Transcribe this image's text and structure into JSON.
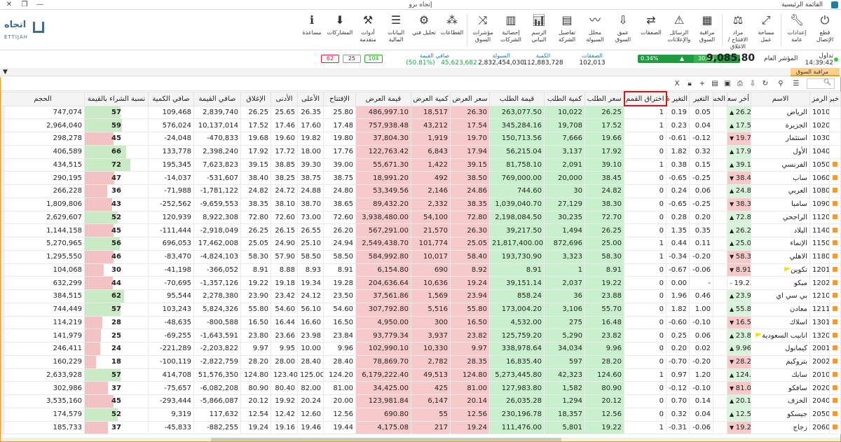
{
  "titlebar": {
    "title": "إتجاه برو",
    "menu": "القائمة الرئيسية"
  },
  "ribbon": [
    {
      "icon": "power-icon",
      "label": "قطع الإتصال"
    },
    {
      "icon": "wrench-icon",
      "label": "إعدادات عامة"
    },
    {
      "icon": "expand-icon",
      "label": "مساحة عمل"
    },
    {
      "icon": "auction-icon",
      "label": "مزاد الافتتاح / الاغلاق"
    },
    {
      "icon": "grid-icon",
      "label": "مراقبة السوق"
    },
    {
      "icon": "alert-icon",
      "label": "الرسائل والإعلانات"
    },
    {
      "icon": "deals-icon",
      "label": "الصفقات"
    },
    {
      "icon": "depth-icon",
      "label": "عمق السوق"
    },
    {
      "icon": "liquidity-icon",
      "label": "محلل السيولة"
    },
    {
      "icon": "company-icon",
      "label": "تفاصيل الشركة"
    },
    {
      "icon": "chart-icon",
      "label": "الرسم البياني"
    },
    {
      "icon": "stats-icon",
      "label": "إحصائية الشركات"
    },
    {
      "icon": "shuffle-icon",
      "label": "مؤشرات السوق"
    },
    {
      "icon": "sectors-icon",
      "label": "القطاعات"
    },
    {
      "icon": "analysis-icon",
      "label": "تحليل فني"
    },
    {
      "icon": "financial-icon",
      "label": "البيانات المالية"
    },
    {
      "icon": "tools-icon",
      "label": "أدوات متقدمة"
    },
    {
      "icon": "subscriptions-icon",
      "label": "المشاركات"
    },
    {
      "icon": "help-icon",
      "label": "مساعدة"
    }
  ],
  "logo": {
    "ar": "اتجاه",
    "en": "ETTIJAH"
  },
  "ticker": {
    "trade_label": "تداول",
    "time": "14:39:42",
    "index_label": "المؤشر العام",
    "index_value": "9,085.80",
    "index_change": "30.46",
    "index_pct": "0.34%",
    "deals_label": "الصفقات",
    "deals_value": "102,013",
    "qty_label": "الكمية",
    "qty_value": "112,883,728",
    "liquidity_label": "السيولة",
    "liquidity_value": "2,832,454,030",
    "netval_label": "صافي القيمة",
    "netval_value": "45,623,682",
    "netval_pct": "(50.81%)",
    "up_count": "104",
    "flat_count": "25",
    "down_count": "62"
  },
  "panel": {
    "title": "مراقبة السوق",
    "search_placeholder": ""
  },
  "columns": [
    "خبر",
    "الرمز",
    "الاسم",
    "أخر سعر",
    "الخسارة",
    "التغير",
    "التغير %",
    "اختراق القمم",
    "سعر الطلب",
    "كمية الطلب",
    "قيمة الطلب",
    "سعر العرض",
    "كمية العرض",
    "قيمة العرض",
    "الإفتتاح",
    "الأعلى",
    "الأدنى",
    "الإغلاق",
    "صافي القيمة",
    "صافي الكمية",
    "نسبة الشراء بالقيمة",
    "الحجم"
  ],
  "rows": [
    {
      "sym": "1010",
      "name": "الرياض",
      "last": "26.25",
      "dir": "up",
      "chg": "0.05",
      "pct": "0.19",
      "brk": "1",
      "bp": "26.25",
      "bq": "10,022",
      "bv": "263,077.50",
      "ap": "26.30",
      "aq": "18,517",
      "av": "486,997.10",
      "open": "25.80",
      "high": "26.35",
      "low": "25.65",
      "close": "26.25",
      "netv": "2,839,740",
      "netq": "109,468",
      "ratio": 57,
      "vol": "747,074",
      "flag": false,
      "rss": false
    },
    {
      "sym": "1020",
      "name": "الجزيرة",
      "last": "17.54",
      "dir": "up",
      "chg": "0.04",
      "pct": "0.23",
      "brk": "1",
      "bp": "17.52",
      "bq": "19,708",
      "bv": "345,284.16",
      "ap": "17.54",
      "aq": "43,212",
      "av": "757,938.48",
      "open": "17.48",
      "high": "17.60",
      "low": "17.46",
      "close": "17.52",
      "netv": "10,137,014",
      "netq": "576,024",
      "ratio": 59,
      "vol": "2,964,040",
      "flag": false,
      "rss": false
    },
    {
      "sym": "1030",
      "name": "استثمار",
      "last": "19.70",
      "dir": "down",
      "chg": "-0.12",
      "pct": "-0.61",
      "brk": "0",
      "bp": "19.66",
      "bq": "7,666",
      "bv": "150,713.56",
      "ap": "19.70",
      "aq": "1,919",
      "av": "37,804.30",
      "open": "19.80",
      "high": "19.82",
      "low": "19.60",
      "close": "19.68",
      "netv": "-470,833",
      "netq": "-24,048",
      "ratio": 45,
      "vol": "298,278",
      "flag": false,
      "rss": false
    },
    {
      "sym": "1040",
      "name": "الأول",
      "last": "17.92",
      "dir": "up",
      "chg": "0.32",
      "pct": "1.82",
      "brk": "0",
      "bp": "17.92",
      "bq": "3,137",
      "bv": "56,215.04",
      "ap": "17.94",
      "aq": "6,843",
      "av": "122,763.42",
      "open": "17.76",
      "high": "18.00",
      "low": "17.72",
      "close": "17.92",
      "netv": "2,398,240",
      "netq": "133,778",
      "ratio": 66,
      "vol": "406,589",
      "flag": false,
      "rss": false
    },
    {
      "sym": "1050",
      "name": "الفرنسي",
      "last": "39.15",
      "dir": "up",
      "chg": "0.15",
      "pct": "0.38",
      "brk": "1",
      "bp": "39.10",
      "bq": "2,091",
      "bv": "81,758.10",
      "ap": "39.15",
      "aq": "1,422",
      "av": "55,671.30",
      "open": "39.00",
      "high": "39.30",
      "low": "38.85",
      "close": "39.15",
      "netv": "7,623,823",
      "netq": "195,345",
      "ratio": 72,
      "vol": "434,515",
      "flag": false,
      "rss": true
    },
    {
      "sym": "1060",
      "name": "ساب",
      "last": "38.40",
      "dir": "down",
      "chg": "-0.25",
      "pct": "-0.65",
      "brk": "0",
      "bp": "38.45",
      "bq": "20,000",
      "bv": "769,000.00",
      "ap": "38.50",
      "aq": "492",
      "av": "18,991.20",
      "open": "38.75",
      "high": "38.75",
      "low": "38.25",
      "close": "38.40",
      "netv": "-531,607",
      "netq": "-14,037",
      "ratio": 47,
      "vol": "290,195",
      "flag": false,
      "rss": true
    },
    {
      "sym": "1080",
      "name": "العربي",
      "last": "24.82",
      "dir": "up",
      "chg": "0.06",
      "pct": "0.24",
      "brk": "0",
      "bp": "24.82",
      "bq": "30",
      "bv": "744.60",
      "ap": "24.86",
      "aq": "2,146",
      "av": "53,349.56",
      "open": "24.80",
      "high": "24.88",
      "low": "24.72",
      "close": "24.82",
      "netv": "-1,781,122",
      "netq": "-71,988",
      "ratio": 36,
      "vol": "266,228",
      "flag": false,
      "rss": true
    },
    {
      "sym": "1090",
      "name": "سامبا",
      "last": "38.35",
      "dir": "down",
      "chg": "-0.25",
      "pct": "-0.65",
      "brk": "0",
      "bp": "38.30",
      "bq": "27,129",
      "bv": "1,039,040.70",
      "ap": "38.35",
      "aq": "2,332",
      "av": "89,432.20",
      "open": "38.65",
      "high": "38.70",
      "low": "38.10",
      "close": "38.35",
      "netv": "-9,659,553",
      "netq": "-252,562",
      "ratio": 43,
      "vol": "1,809,806",
      "flag": false,
      "rss": true
    },
    {
      "sym": "1120",
      "name": "الراجحي",
      "last": "72.80",
      "dir": "up",
      "chg": "0.20",
      "pct": "0.28",
      "brk": "0",
      "bp": "72.70",
      "bq": "30,235",
      "bv": "2,198,084.50",
      "ap": "72.80",
      "aq": "54,100",
      "av": "3,938,480.00",
      "open": "72.60",
      "high": "73.00",
      "low": "72.60",
      "close": "72.80",
      "netv": "8,922,308",
      "netq": "120,939",
      "ratio": 52,
      "vol": "2,629,607",
      "flag": false,
      "rss": true
    },
    {
      "sym": "1140",
      "name": "البلاد",
      "last": "26.25",
      "dir": "up",
      "chg": "0.35",
      "pct": "1.35",
      "brk": "0",
      "bp": "26.25",
      "bq": "1,494",
      "bv": "39,217.50",
      "ap": "26.30",
      "aq": "21,570",
      "av": "567,291.00",
      "open": "26.20",
      "high": "26.55",
      "low": "26.15",
      "close": "26.25",
      "netv": "-2,918,049",
      "netq": "-111,444",
      "ratio": 45,
      "vol": "1,144,158",
      "flag": false,
      "rss": true
    },
    {
      "sym": "1150",
      "name": "الإنماء",
      "last": "25.05",
      "dir": "up",
      "chg": "0.11",
      "pct": "0.44",
      "brk": "1",
      "bp": "25.00",
      "bq": "872,696",
      "bv": "21,817,400.00",
      "ap": "25.05",
      "aq": "101,774",
      "av": "2,549,438.70",
      "open": "24.94",
      "high": "25.10",
      "low": "24.90",
      "close": "25.05",
      "netv": "17,462,008",
      "netq": "696,053",
      "ratio": 56,
      "vol": "5,270,965",
      "flag": false,
      "rss": true
    },
    {
      "sym": "1180",
      "name": "الاهلي",
      "last": "58.30",
      "dir": "down",
      "chg": "-0.20",
      "pct": "-0.34",
      "brk": "1",
      "bp": "58.30",
      "bq": "3,323",
      "bv": "193,730.90",
      "ap": "58.40",
      "aq": "10,017",
      "av": "584,992.80",
      "open": "58.50",
      "high": "58.50",
      "low": "57.90",
      "close": "58.30",
      "netv": "-4,824,103",
      "netq": "-83,470",
      "ratio": 46,
      "vol": "1,295,550",
      "flag": false,
      "rss": true
    },
    {
      "sym": "1201",
      "name": "تكوين",
      "last": "8.91",
      "dir": "down",
      "chg": "-0.06",
      "pct": "-0.67",
      "brk": "0",
      "bp": "8.91",
      "bq": "1",
      "bv": "8.91",
      "ap": "8.92",
      "aq": "690",
      "av": "6,154.80",
      "open": "8.91",
      "high": "8.93",
      "low": "8.88",
      "close": "8.91",
      "netv": "-366,052",
      "netq": "-41,198",
      "ratio": 30,
      "vol": "104,068",
      "flag": true,
      "rss": true
    },
    {
      "sym": "1202",
      "name": "مبكو",
      "last": "19.22",
      "dir": "flat",
      "chg": "-",
      "pct": "0.00",
      "brk": "0",
      "bp": "19.22",
      "bq": "2,037",
      "bv": "39,151.14",
      "ap": "19.24",
      "aq": "10,636",
      "av": "204,636.64",
      "open": "19.28",
      "high": "19.34",
      "low": "19.18",
      "close": "19.22",
      "netv": "-1,357,126",
      "netq": "-70,695",
      "ratio": 44,
      "vol": "632,299",
      "flag": false,
      "rss": true
    },
    {
      "sym": "1210",
      "name": "بي سي اي",
      "last": "23.90",
      "dir": "up",
      "chg": "0.46",
      "pct": "1.96",
      "brk": "0",
      "bp": "23.88",
      "bq": "36",
      "bv": "858.24",
      "ap": "23.94",
      "aq": "1,569",
      "av": "37,561.86",
      "open": "23.50",
      "high": "24.12",
      "low": "23.42",
      "close": "23.90",
      "netv": "2,278,380",
      "netq": "95,544",
      "ratio": 62,
      "vol": "384,515",
      "flag": false,
      "rss": true
    },
    {
      "sym": "1211",
      "name": "معادن",
      "last": "55.80",
      "dir": "up",
      "chg": "1.00",
      "pct": "1.82",
      "brk": "0",
      "bp": "55.70",
      "bq": "3,106",
      "bv": "173,004.20",
      "ap": "55.80",
      "aq": "5,516",
      "av": "307,792.80",
      "open": "54.60",
      "high": "56.10",
      "low": "54.60",
      "close": "55.80",
      "netv": "5,824,326",
      "netq": "103,243",
      "ratio": 57,
      "vol": "744,449",
      "flag": false,
      "rss": true
    },
    {
      "sym": "1301",
      "name": "اسلاك",
      "last": "16.50",
      "dir": "down",
      "chg": "-0.10",
      "pct": "-0.60",
      "brk": "0",
      "bp": "16.48",
      "bq": "275",
      "bv": "4,532.00",
      "ap": "16.50",
      "aq": "300",
      "av": "4,950.00",
      "open": "16.50",
      "high": "16.60",
      "low": "16.44",
      "close": "16.50",
      "netv": "-800,588",
      "netq": "-48,635",
      "ratio": 28,
      "vol": "114,219",
      "flag": false,
      "rss": true
    },
    {
      "sym": "1320",
      "name": "انابيب السعودية",
      "last": "23.80",
      "dir": "up",
      "chg": "0.06",
      "pct": "0.25",
      "brk": "0",
      "bp": "23.82",
      "bq": "5,290",
      "bv": "125,759.20",
      "ap": "23.82",
      "aq": "3,937",
      "av": "93,779.34",
      "open": "23.84",
      "high": "23.98",
      "low": "23.66",
      "close": "23.80",
      "netv": "-1,643,591",
      "netq": "-69,255",
      "ratio": 25,
      "vol": "141,979",
      "flag": true,
      "rss": true
    },
    {
      "sym": "2001",
      "name": "كيمانول",
      "last": "9.96",
      "dir": "up",
      "chg": "0.02",
      "pct": "0.20",
      "brk": "0",
      "bp": "9.96",
      "bq": "34,034",
      "bv": "338,978.64",
      "ap": "9.97",
      "aq": "10,330",
      "av": "102,990.10",
      "open": "9.96",
      "high": "10.00",
      "low": "9.95",
      "close": "9.97",
      "netv": "-2,203,822",
      "netq": "-221,289",
      "ratio": 24,
      "vol": "246,411",
      "flag": false,
      "rss": true
    },
    {
      "sym": "2002",
      "name": "بتروكيم",
      "last": "28.20",
      "dir": "down",
      "chg": "-0.20",
      "pct": "-0.70",
      "brk": "0",
      "bp": "28.20",
      "bq": "597",
      "bv": "16,835.40",
      "ap": "28.35",
      "aq": "2,782",
      "av": "78,869.70",
      "open": "28.40",
      "high": "28.40",
      "low": "28.00",
      "close": "28.20",
      "netv": "-2,822,759",
      "netq": "-100,119",
      "ratio": 18,
      "vol": "160,229",
      "flag": false,
      "rss": true
    },
    {
      "sym": "2010",
      "name": "سابك",
      "last": "124.80",
      "dir": "up",
      "chg": "1.20",
      "pct": "0.97",
      "brk": "1",
      "bp": "124.60",
      "bq": "42,323",
      "bv": "5,273,445.80",
      "ap": "124.80",
      "aq": "49,513",
      "av": "6,179,222.40",
      "open": "124.20",
      "high": "125.00",
      "low": "123.40",
      "close": "124.80",
      "netv": "51,576,350",
      "netq": "414,708",
      "ratio": 57,
      "vol": "2,633,928",
      "flag": false,
      "rss": true
    },
    {
      "sym": "2020",
      "name": "سافكو",
      "last": "81.00",
      "dir": "down",
      "chg": "-0.10",
      "pct": "-0.12",
      "brk": "0",
      "bp": "80.90",
      "bq": "1,582",
      "bv": "127,983.80",
      "ap": "81.00",
      "aq": "425",
      "av": "34,425.00",
      "open": "81.00",
      "high": "82.00",
      "low": "80.40",
      "close": "80.90",
      "netv": "-6,082,208",
      "netq": "-75,657",
      "ratio": 37,
      "vol": "302,986",
      "flag": false,
      "rss": true
    },
    {
      "sym": "2040",
      "name": "الخزف",
      "last": "20.12",
      "dir": "up",
      "chg": "0.14",
      "pct": "0.70",
      "brk": "0",
      "bp": "20.12",
      "bq": "1,294",
      "bv": "26,035.28",
      "ap": "20.14",
      "aq": "6,147",
      "av": "123,981.84",
      "open": "20.00",
      "high": "20.24",
      "low": "19.92",
      "close": "20.12",
      "netv": "-5,866,087",
      "netq": "-293,444",
      "ratio": 45,
      "vol": "3,535,160",
      "flag": false,
      "rss": true
    },
    {
      "sym": "2050",
      "name": "جيسكو",
      "last": "12.58",
      "dir": "up",
      "chg": "0.04",
      "pct": "0.32",
      "brk": "0",
      "bp": "12.56",
      "bq": "18,357",
      "bv": "230,196.78",
      "ap": "12.56",
      "aq": "55",
      "av": "690.80",
      "open": "12.56",
      "high": "12.60",
      "low": "12.42",
      "close": "12.54",
      "netv": "117,632",
      "netq": "9,319",
      "ratio": 52,
      "vol": "174,579",
      "flag": false,
      "rss": true
    },
    {
      "sym": "2060",
      "name": "زجاج",
      "last": "19.24",
      "dir": "down",
      "chg": "-0.06",
      "pct": "-0.31",
      "brk": "1",
      "bp": "19.22",
      "bq": "5,801",
      "bv": "111,476.00",
      "ap": "19.24",
      "aq": "217",
      "av": "4,175.08",
      "open": "19.44",
      "high": "19.46",
      "low": "19.16",
      "close": "19.24",
      "netv": "-882,255",
      "netq": "-45,833",
      "ratio": 37,
      "vol": "185,733",
      "flag": false,
      "rss": true
    }
  ]
}
